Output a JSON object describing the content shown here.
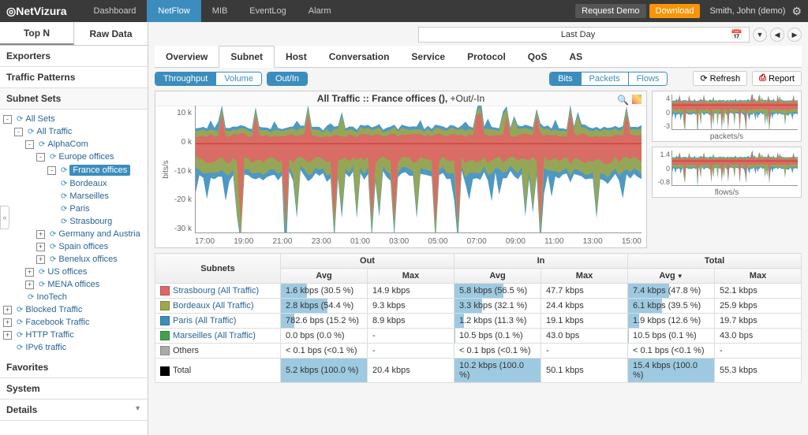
{
  "app": {
    "name": "NetVizura"
  },
  "nav": {
    "items": [
      "Dashboard",
      "NetFlow",
      "MIB",
      "EventLog",
      "Alarm"
    ],
    "active": 1
  },
  "topbar": {
    "request_demo": "Request Demo",
    "download": "Download",
    "user": "Smith, John (demo)"
  },
  "daterange": {
    "label": "Last Day"
  },
  "side_tabs": {
    "items": [
      "Top N",
      "Raw Data"
    ],
    "active": 0
  },
  "side_sections": [
    "Exporters",
    "Traffic Patterns",
    "Subnet Sets",
    "Favorites",
    "System",
    "Details"
  ],
  "tree": [
    {
      "lvl": 0,
      "exp": "-",
      "label": "All Sets"
    },
    {
      "lvl": 1,
      "exp": "-",
      "label": "All Traffic"
    },
    {
      "lvl": 2,
      "exp": "-",
      "label": "AlphaCom"
    },
    {
      "lvl": 3,
      "exp": "-",
      "label": "Europe offices"
    },
    {
      "lvl": 4,
      "exp": "-",
      "label": "France offices",
      "selected": true
    },
    {
      "lvl": 4,
      "exp": "",
      "label": "Bordeaux",
      "leaf": true
    },
    {
      "lvl": 4,
      "exp": "",
      "label": "Marseilles",
      "leaf": true
    },
    {
      "lvl": 4,
      "exp": "",
      "label": "Paris",
      "leaf": true
    },
    {
      "lvl": 4,
      "exp": "",
      "label": "Strasbourg",
      "leaf": true
    },
    {
      "lvl": 3,
      "exp": "+",
      "label": "Germany and Austria"
    },
    {
      "lvl": 3,
      "exp": "+",
      "label": "Spain offices"
    },
    {
      "lvl": 3,
      "exp": "+",
      "label": "Benelux offices"
    },
    {
      "lvl": 2,
      "exp": "+",
      "label": "US offices"
    },
    {
      "lvl": 2,
      "exp": "+",
      "label": "MENA offices"
    },
    {
      "lvl": 1,
      "exp": "",
      "label": "InoTech",
      "leaf": true
    },
    {
      "lvl": 0,
      "exp": "+",
      "label": "Blocked Traffic"
    },
    {
      "lvl": 0,
      "exp": "+",
      "label": "Facebook Traffic"
    },
    {
      "lvl": 0,
      "exp": "+",
      "label": "HTTP Traffic"
    },
    {
      "lvl": 0,
      "exp": "",
      "label": "IPv6 traffic",
      "leaf": true
    }
  ],
  "content_tabs": {
    "items": [
      "Overview",
      "Subnet",
      "Host",
      "Conversation",
      "Service",
      "Protocol",
      "QoS",
      "AS"
    ],
    "active": 1
  },
  "toolbar": {
    "left1": {
      "options": [
        "Throughput",
        "Volume"
      ],
      "active": 0
    },
    "left2": {
      "options": [
        "Out/In"
      ],
      "active": 0
    },
    "right1": {
      "options": [
        "Bits",
        "Packets",
        "Flows"
      ],
      "active": 0
    },
    "refresh": "Refresh",
    "report": "Report"
  },
  "chart": {
    "title_prefix": "All Traffic :: France offices (), ",
    "title_suffix": "+Out/-In",
    "yaxis_label": "bits/s",
    "y_ticks": [
      "10 k",
      "0 k",
      "-10 k",
      "-20 k",
      "-30 k"
    ],
    "x_ticks": [
      "17:00",
      "19:00",
      "21:00",
      "23:00",
      "01:00",
      "03:00",
      "05:00",
      "07:00",
      "09:00",
      "11:00",
      "13:00",
      "15:00"
    ]
  },
  "mini1": {
    "label": "packets/s",
    "y_ticks": [
      "4",
      "0",
      "-3"
    ]
  },
  "mini2": {
    "label": "flows/s",
    "y_ticks": [
      "1.4",
      "0",
      "-0.8"
    ]
  },
  "table": {
    "header_groups": [
      "",
      "Out",
      "In",
      "Total"
    ],
    "cols": [
      "Subnets",
      "Avg",
      "Max",
      "Avg",
      "Max",
      "Avg",
      "Max"
    ],
    "sort_col": 5,
    "rows": [
      {
        "color": "#e06666",
        "name": "Strasbourg (All Traffic)",
        "link": true,
        "out_avg": "1.6 kbps (30.5 %)",
        "out_avg_bar": 30.5,
        "out_max": "14.9 kbps",
        "in_avg": "5.8 kbps (56.5 %)",
        "in_avg_bar": 56.5,
        "in_max": "47.7 kbps",
        "tot_avg": "7.4 kbps (47.8 %)",
        "tot_avg_bar": 47.8,
        "tot_max": "52.1 kbps"
      },
      {
        "color": "#9da84a",
        "name": "Bordeaux (All Traffic)",
        "link": true,
        "out_avg": "2.8 kbps (54.4 %)",
        "out_avg_bar": 54.4,
        "out_max": "9.3 kbps",
        "in_avg": "3.3 kbps (32.1 %)",
        "in_avg_bar": 32.1,
        "in_max": "24.4 kbps",
        "tot_avg": "6.1 kbps (39.5 %)",
        "tot_avg_bar": 39.5,
        "tot_max": "25.9 kbps"
      },
      {
        "color": "#3b8dbd",
        "name": "Paris (All Traffic)",
        "link": true,
        "out_avg": "782.6 bps (15.2 %)",
        "out_avg_bar": 15.2,
        "out_max": "8.9 kbps",
        "in_avg": "1.2 kbps (11.3 %)",
        "in_avg_bar": 11.3,
        "in_max": "19.1 kbps",
        "tot_avg": "1.9 kbps (12.6 %)",
        "tot_avg_bar": 12.6,
        "tot_max": "19.7 kbps"
      },
      {
        "color": "#3fa34d",
        "name": "Marseilles (All Traffic)",
        "link": true,
        "out_avg": "0.0 bps (0.0 %)",
        "out_avg_bar": 0,
        "out_max": "-",
        "in_avg": "10.5 bps (0.1 %)",
        "in_avg_bar": 0.1,
        "in_max": "43.0 bps",
        "tot_avg": "10.5 bps (0.1 %)",
        "tot_avg_bar": 0.1,
        "tot_max": "43.0 bps"
      },
      {
        "color": "#aaaaaa",
        "name": "Others",
        "link": false,
        "out_avg": "< 0.1 bps (<0.1 %)",
        "out_avg_bar": 0,
        "out_max": "-",
        "in_avg": "< 0.1 bps (<0.1 %)",
        "in_avg_bar": 0,
        "in_max": "-",
        "tot_avg": "< 0.1 bps (<0.1 %)",
        "tot_avg_bar": 0,
        "tot_max": "-"
      },
      {
        "color": "#000000",
        "name": "Total",
        "link": false,
        "out_avg": "5.2 kbps (100.0 %)",
        "out_avg_bar": 100,
        "out_max": "20.4 kbps",
        "in_avg": "10.2 kbps (100.0 %)",
        "in_avg_bar": 100,
        "in_max": "50.1 kbps",
        "tot_avg": "15.4 kbps (100.0 %)",
        "tot_avg_bar": 100,
        "tot_max": "55.3 kbps"
      }
    ]
  },
  "chart_data": {
    "type": "area",
    "title": "All Traffic :: France offices (), +Out/-In",
    "xlabel": "",
    "ylabel": "bits/s",
    "ylim": [
      -35000,
      15000
    ],
    "x": [
      "17:00",
      "19:00",
      "21:00",
      "23:00",
      "01:00",
      "03:00",
      "05:00",
      "07:00",
      "09:00",
      "11:00",
      "13:00",
      "15:00"
    ],
    "series": [
      {
        "name": "Strasbourg out",
        "color": "#e06666",
        "values": [
          2,
          2,
          2,
          1,
          1,
          1,
          2,
          1,
          1,
          1,
          2,
          2
        ]
      },
      {
        "name": "Bordeaux out",
        "color": "#9da84a",
        "values": [
          3,
          3,
          3,
          2,
          2,
          2,
          3,
          2,
          2,
          3,
          3,
          3
        ]
      },
      {
        "name": "Paris out",
        "color": "#3b8dbd",
        "values": [
          1,
          1,
          1,
          1,
          1,
          1,
          1,
          1,
          1,
          1,
          1,
          1
        ]
      },
      {
        "name": "Strasbourg in",
        "color": "#e06666",
        "values": [
          -6,
          -6,
          -6,
          -5,
          -4,
          -4,
          -10,
          -4,
          -4,
          -5,
          -8,
          -7
        ]
      },
      {
        "name": "Bordeaux in",
        "color": "#9da84a",
        "values": [
          -4,
          -4,
          -4,
          -3,
          -3,
          -3,
          -4,
          -3,
          -3,
          -4,
          -5,
          -4
        ]
      },
      {
        "name": "Paris in",
        "color": "#3b8dbd",
        "values": [
          -2,
          -2,
          -2,
          -1,
          -1,
          -1,
          -2,
          -1,
          -1,
          -2,
          -3,
          -2
        ]
      }
    ]
  }
}
